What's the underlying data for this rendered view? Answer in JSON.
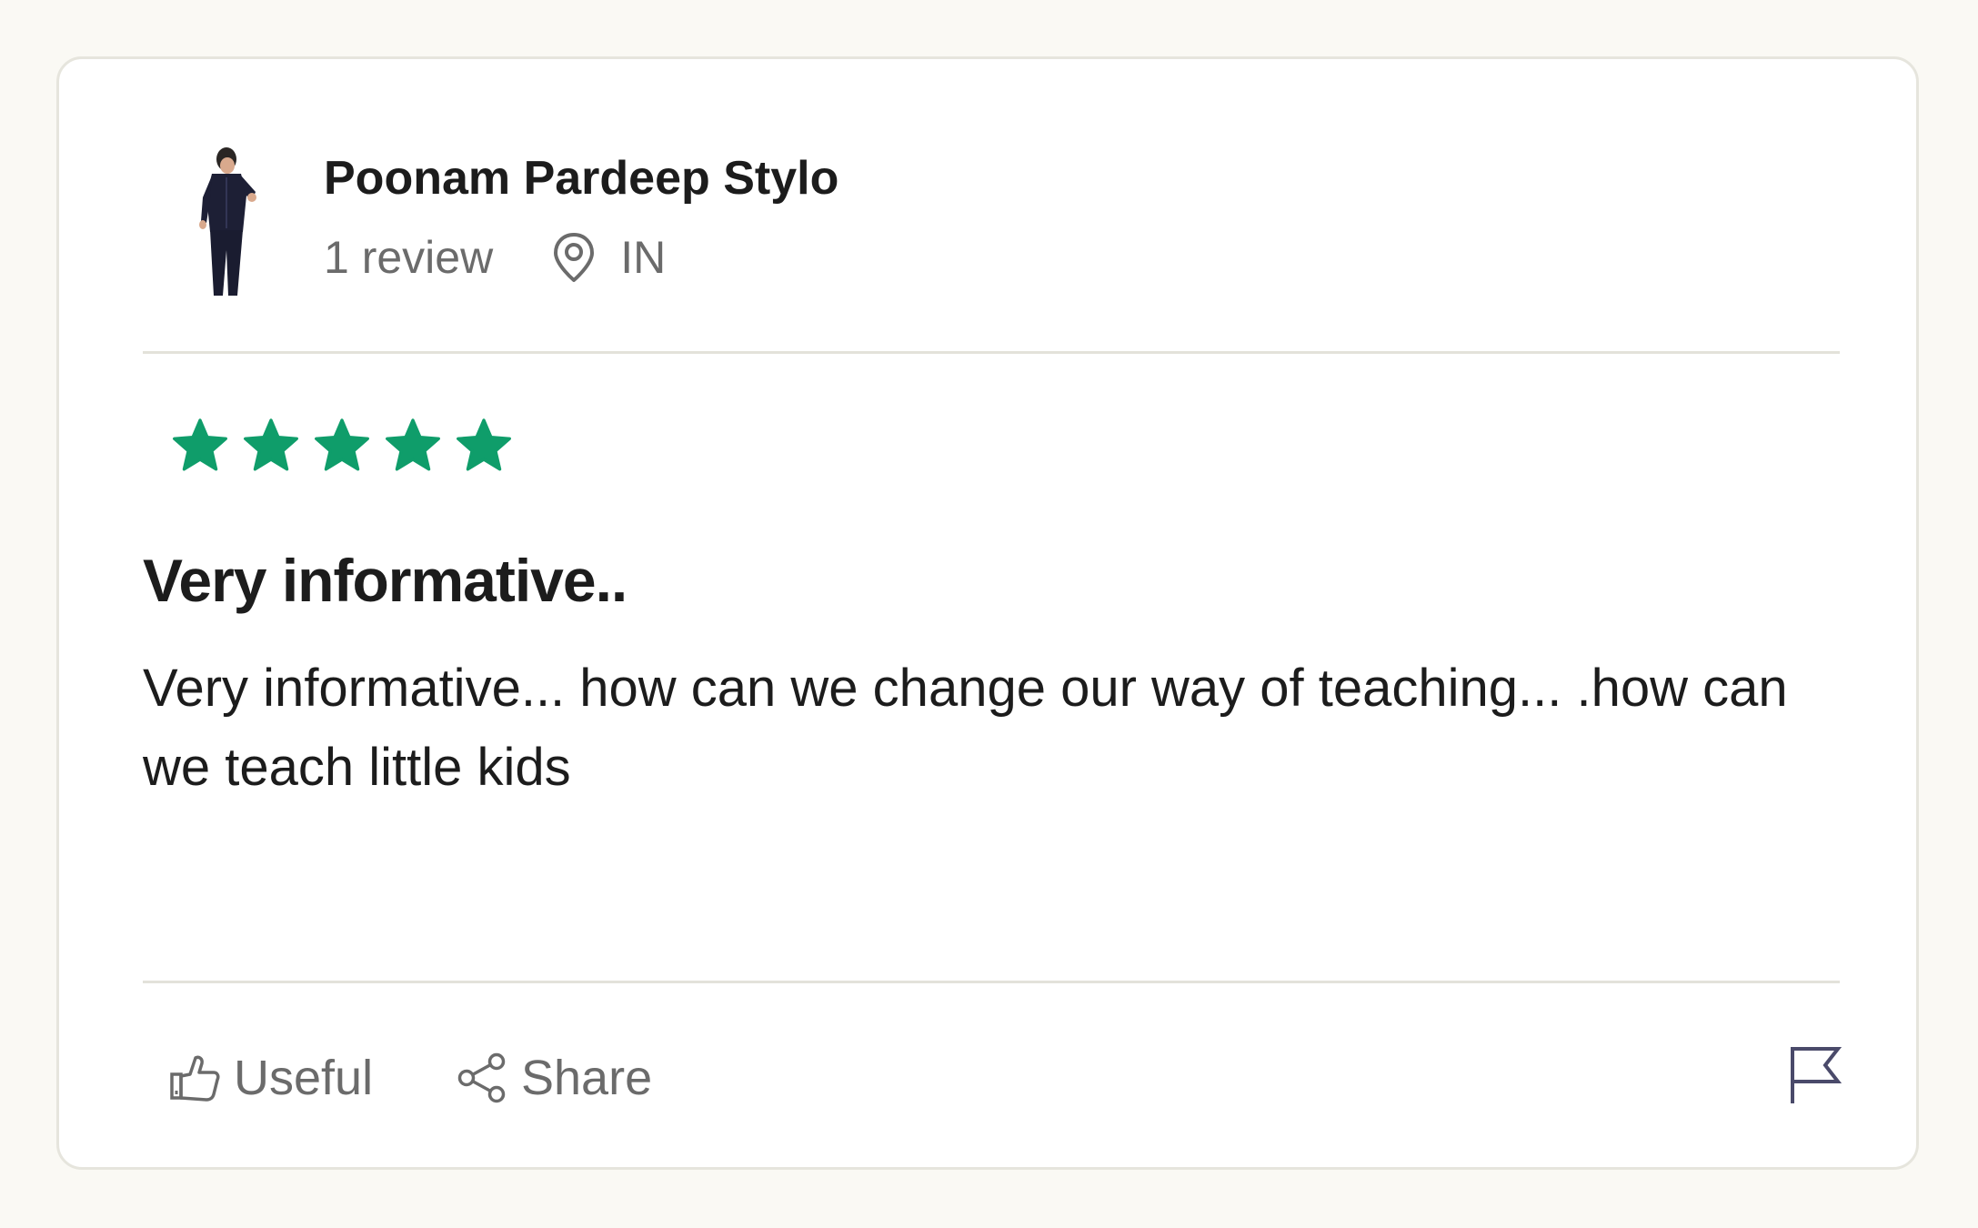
{
  "reviewer": {
    "name": "Poonam Pardeep Stylo",
    "review_count": "1 review",
    "location": "IN"
  },
  "rating": {
    "stars": 5,
    "max": 5,
    "color": "#0f9d6a"
  },
  "review": {
    "title": "Very informative..",
    "body": "Very informative... how can we change our way of teaching... .how can we teach little kids"
  },
  "actions": {
    "useful_label": "Useful",
    "share_label": "Share"
  },
  "icons": {
    "location": "location-pin-icon",
    "useful": "thumbs-up-icon",
    "share": "share-icon",
    "report": "flag-icon"
  }
}
